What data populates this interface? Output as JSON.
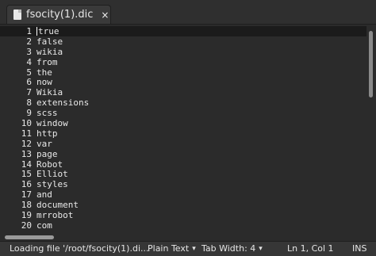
{
  "tab": {
    "title": "fsocity(1).dic",
    "close_glyph": "×"
  },
  "editor": {
    "lines": [
      {
        "n": "1",
        "text": "true"
      },
      {
        "n": "2",
        "text": "false"
      },
      {
        "n": "3",
        "text": "wikia"
      },
      {
        "n": "4",
        "text": "from"
      },
      {
        "n": "5",
        "text": "the"
      },
      {
        "n": "6",
        "text": "now"
      },
      {
        "n": "7",
        "text": "Wikia"
      },
      {
        "n": "8",
        "text": "extensions"
      },
      {
        "n": "9",
        "text": "scss"
      },
      {
        "n": "10",
        "text": "window"
      },
      {
        "n": "11",
        "text": "http"
      },
      {
        "n": "12",
        "text": "var"
      },
      {
        "n": "13",
        "text": "page"
      },
      {
        "n": "14",
        "text": "Robot"
      },
      {
        "n": "15",
        "text": "Elliot"
      },
      {
        "n": "16",
        "text": "styles"
      },
      {
        "n": "17",
        "text": "and"
      },
      {
        "n": "18",
        "text": "document"
      },
      {
        "n": "19",
        "text": "mrrobot"
      },
      {
        "n": "20",
        "text": "com"
      }
    ]
  },
  "status": {
    "message": "Loading file '/root/fsocity(1).di...",
    "language": "Plain Text",
    "tab_width": "Tab Width: 4",
    "position": "Ln 1, Col 1",
    "mode": "INS"
  },
  "icons": {
    "file": "file-icon",
    "close": "close-icon",
    "dropdown": "chevron-down-icon"
  }
}
